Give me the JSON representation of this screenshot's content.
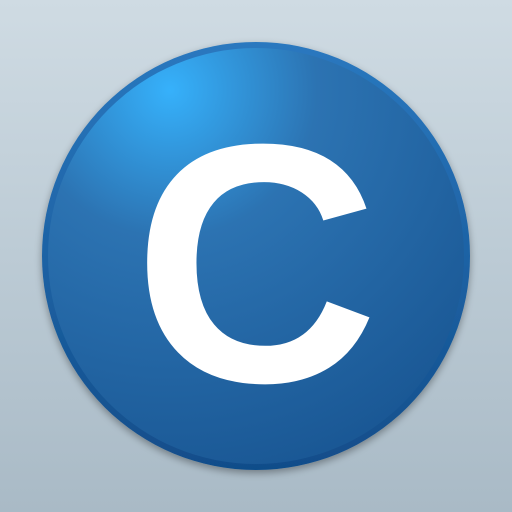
{
  "app_icon": {
    "glyph": "C",
    "colors": {
      "background_top": "#cfdbe3",
      "background_bottom": "#a9bac6",
      "circle_highlight": "#36b1fb",
      "circle_mid": "#2c73b2",
      "circle_dark": "#185592",
      "circle_rim": "#114d8a",
      "glyph": "#ffffff"
    }
  }
}
